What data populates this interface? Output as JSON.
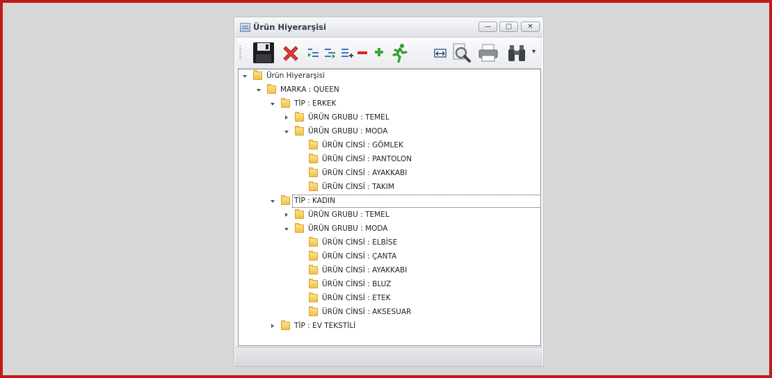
{
  "window": {
    "title": "Ürün Hiyerarşisi"
  },
  "titlebar_buttons": {
    "minimize": "—",
    "maximize": "▢",
    "close": "✕"
  },
  "toolbar": {
    "icons": [
      "save-icon",
      "delete-icon",
      "outdent-icon",
      "indent-icon",
      "add-list-icon",
      "remove-icon",
      "add-icon",
      "exit-run-icon",
      "fit-width-icon",
      "print-preview-icon",
      "print-icon",
      "find-binoculars-icon"
    ],
    "dropdown": "▾"
  },
  "tree": {
    "root": "Ürün Hiyerarşisi",
    "brand": "MARKA : QUEEN",
    "tip_erkek": "TİP : ERKEK",
    "erkek_grubu_temel": "ÜRÜN GRUBU : TEMEL",
    "erkek_grubu_moda": "ÜRÜN GRUBU : MODA",
    "erkek_cinsi_gomlek": "ÜRÜN CİNSİ : GÖMLEK",
    "erkek_cinsi_pantolon": "ÜRÜN CİNSİ : PANTOLON",
    "erkek_cinsi_ayakkabi": "ÜRÜN CİNSİ : AYAKKABI",
    "erkek_cinsi_takim": "ÜRÜN CİNSİ : TAKIM",
    "tip_kadin": "TİP : KADIN",
    "kadin_grubu_temel": "ÜRÜN GRUBU : TEMEL",
    "kadin_grubu_moda": "ÜRÜN GRUBU : MODA",
    "kadin_cinsi_elbise": "ÜRÜN CİNSİ : ELBİSE",
    "kadin_cinsi_canta": "ÜRÜN CİNSİ : ÇANTA",
    "kadin_cinsi_ayakkabi": "ÜRÜN CİNSİ : AYAKKABI",
    "kadin_cinsi_bluz": "ÜRÜN CİNSİ : BLUZ",
    "kadin_cinsi_etek": "ÜRÜN CİNSİ : ETEK",
    "kadin_cinsi_aksesuar": "ÜRÜN CİNSİ : AKSESUAR",
    "tip_ev_tekstili": "TİP : EV TEKSTİLİ"
  },
  "status": {
    "text": ""
  }
}
